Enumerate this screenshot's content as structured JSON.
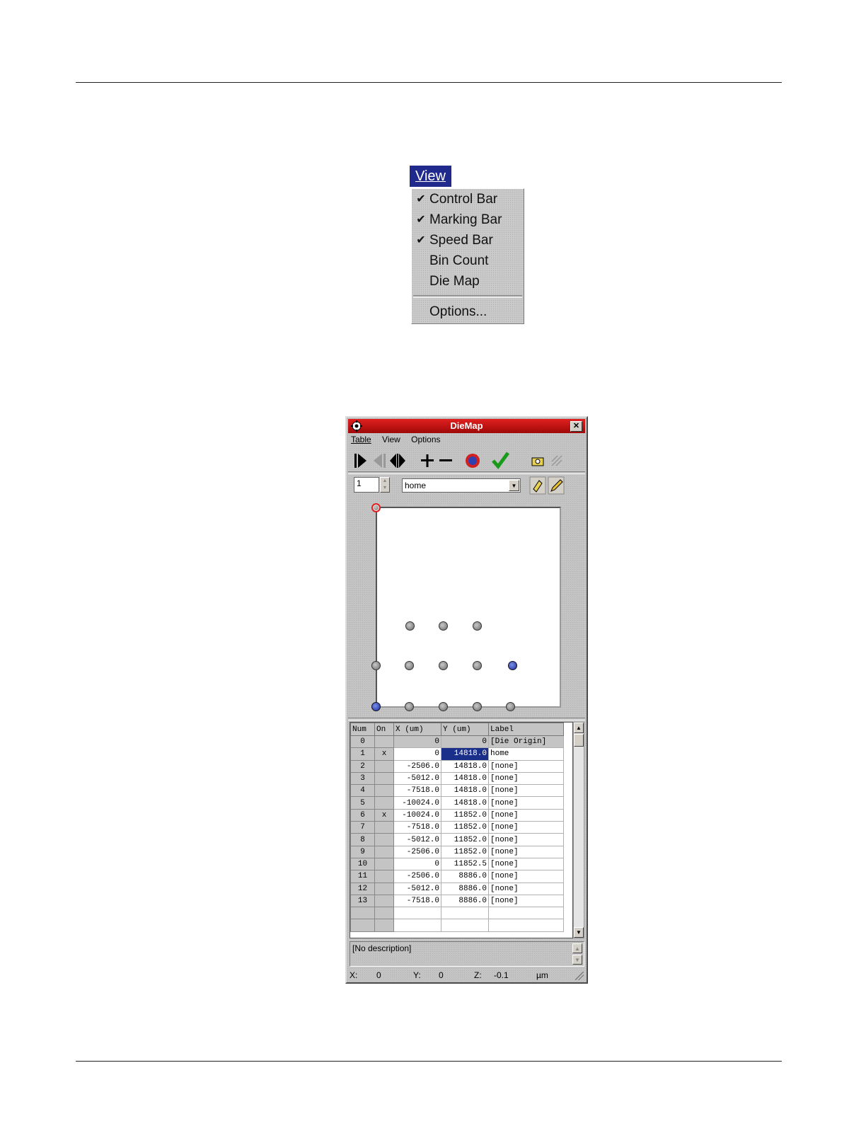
{
  "view_menu": {
    "title": "View",
    "items": [
      {
        "label": "Control Bar",
        "checked": true
      },
      {
        "label": "Marking Bar",
        "checked": true
      },
      {
        "label": "Speed Bar",
        "checked": true
      },
      {
        "label": "Bin Count",
        "checked": false
      },
      {
        "label": "Die Map",
        "checked": false
      }
    ],
    "options_label": "Options..."
  },
  "window": {
    "title": "DieMap",
    "menu": [
      "Table",
      "View",
      "Options"
    ],
    "spin_value": "1",
    "location_select": "home"
  },
  "table": {
    "headers": [
      "Num",
      "On",
      "X (um)",
      "Y (um)",
      "Label"
    ],
    "rows": [
      {
        "num": "0",
        "on": "",
        "x": "0",
        "y": "0",
        "label": "[Die Origin]"
      },
      {
        "num": "1",
        "on": "x",
        "x": "0",
        "y": "14818.0",
        "label": "home"
      },
      {
        "num": "2",
        "on": "",
        "x": "-2506.0",
        "y": "14818.0",
        "label": "[none]"
      },
      {
        "num": "3",
        "on": "",
        "x": "-5012.0",
        "y": "14818.0",
        "label": "[none]"
      },
      {
        "num": "4",
        "on": "",
        "x": "-7518.0",
        "y": "14818.0",
        "label": "[none]"
      },
      {
        "num": "5",
        "on": "",
        "x": "-10024.0",
        "y": "14818.0",
        "label": "[none]"
      },
      {
        "num": "6",
        "on": "x",
        "x": "-10024.0",
        "y": "11852.0",
        "label": "[none]"
      },
      {
        "num": "7",
        "on": "",
        "x": "-7518.0",
        "y": "11852.0",
        "label": "[none]"
      },
      {
        "num": "8",
        "on": "",
        "x": "-5012.0",
        "y": "11852.0",
        "label": "[none]"
      },
      {
        "num": "9",
        "on": "",
        "x": "-2506.0",
        "y": "11852.0",
        "label": "[none]"
      },
      {
        "num": "10",
        "on": "",
        "x": "0",
        "y": "11852.5",
        "label": "[none]"
      },
      {
        "num": "11",
        "on": "",
        "x": "-2506.0",
        "y": "8886.0",
        "label": "[none]"
      },
      {
        "num": "12",
        "on": "",
        "x": "-5012.0",
        "y": "8886.0",
        "label": "[none]"
      },
      {
        "num": "13",
        "on": "",
        "x": "-7518.0",
        "y": "8886.0",
        "label": "[none]"
      }
    ]
  },
  "description": "[No description]",
  "status": {
    "x_label": "X:",
    "x_value": "0",
    "y_label": "Y:",
    "y_value": "0",
    "z_label": "Z:",
    "z_value": "-0.1",
    "unit": "µm"
  }
}
